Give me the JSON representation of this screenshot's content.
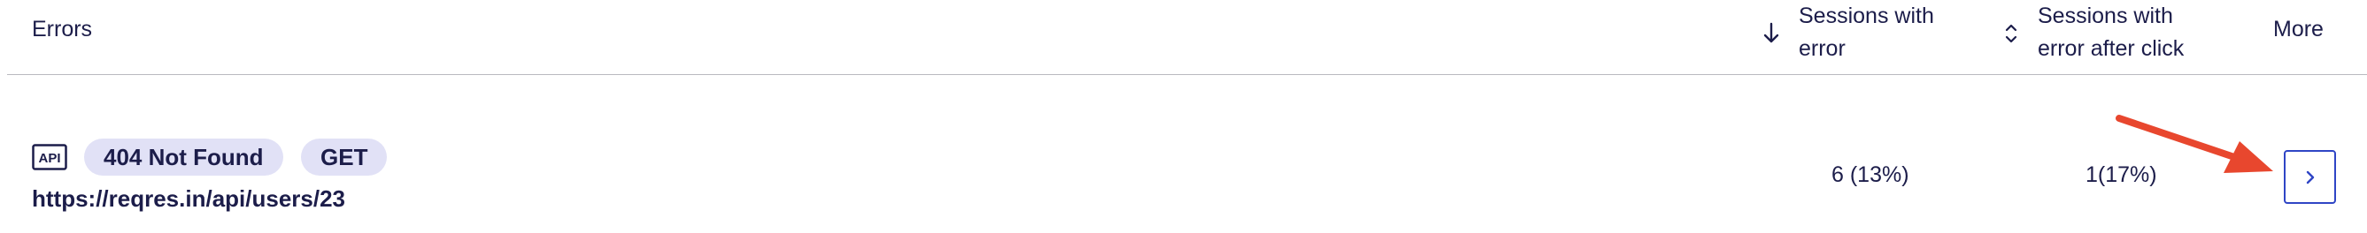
{
  "header": {
    "errors_label": "Errors",
    "sessions_with_error_line1": "Sessions with",
    "sessions_with_error_line2": "error",
    "sessions_after_click_line1": "Sessions with",
    "sessions_after_click_line2": "error after click",
    "more_label": "More",
    "sort_icons": [
      "arrow-down-icon",
      "sort-up-down-icon"
    ]
  },
  "rows": [
    {
      "type_icon": "api-icon",
      "type_icon_text": "API",
      "status_badge": "404 Not Found",
      "method_badge": "GET",
      "url": "https://reqres.in/api/users/23",
      "sessions_with_error": "6 (13%)",
      "sessions_after_click": "1(17%)",
      "more_icon": "chevron-right-icon"
    }
  ],
  "colors": {
    "text": "#1c1d4a",
    "badge_bg": "#e1e1f6",
    "button_border": "#2f45c5",
    "annotation_arrow": "#e8472e",
    "divider": "#b9b9bf"
  }
}
